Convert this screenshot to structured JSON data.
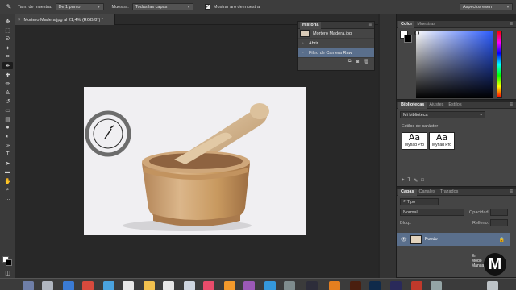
{
  "options_bar": {
    "sample_size_label": "Tam. de muestra:",
    "sample_size_value": "De 1 punto",
    "sample_label": "Muestra:",
    "sample_value": "Todas las capas",
    "show_ring_label": "Mostrar aro de muestra",
    "workspace_value": "Aspectos esen"
  },
  "document_tab": {
    "title": "Mortero Madera.jpg al 21,4% (RGB/8*) *"
  },
  "history_panel": {
    "tab_active": "Historia",
    "items": [
      {
        "label": "Mortero Madera.jpg"
      },
      {
        "label": "Abrir"
      },
      {
        "label": "Filtro de Camera Raw"
      }
    ]
  },
  "color_panel": {
    "tabs": [
      "Color",
      "Muestras"
    ],
    "fg_color": "#ffffff",
    "bg_color": "#000000"
  },
  "libraries_panel": {
    "tabs": [
      "Bibliotecas",
      "Ajustes",
      "Estilos"
    ],
    "library_name": "Mi biblioteca",
    "section_label": "Estilos de carácter",
    "char_styles": [
      {
        "glyph": "Aa",
        "font": "Myriad Pro"
      },
      {
        "glyph": "Aa",
        "font": "Myriad Pro"
      }
    ]
  },
  "layers_panel": {
    "tabs": [
      "Capas",
      "Canales",
      "Trazados"
    ],
    "kind_filter": "Tipo",
    "blend_mode": "Normal",
    "opacity_label": "Opacidad:",
    "lock_label": "Bloq.:",
    "fill_label": "Relleno:",
    "layers": [
      {
        "name": "Fondo"
      }
    ]
  },
  "watermark": {
    "line1": "En",
    "line2": "Modo",
    "line3": "Manual",
    "letter": "M"
  },
  "accent_color": "#5a6f8c"
}
